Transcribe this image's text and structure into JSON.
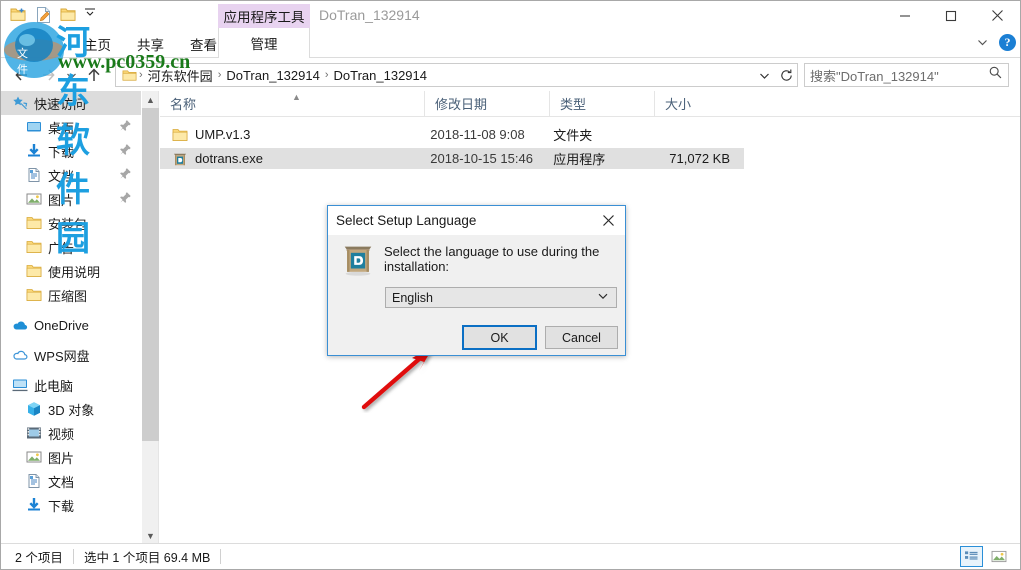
{
  "window": {
    "title": "DoTran_132914",
    "controls": {
      "minimize": "minimize-icon",
      "maximize": "maximize-icon",
      "close": "close-icon"
    },
    "help_label": "?"
  },
  "ribbon": {
    "tabs": [
      {
        "label": "主页",
        "name": "tab-home"
      },
      {
        "label": "共享",
        "name": "tab-share"
      },
      {
        "label": "查看",
        "name": "tab-view"
      }
    ],
    "contextual": {
      "band_label": "应用程序工具",
      "tab_label": "管理",
      "band_color": "#e8d3f0"
    },
    "collapse_icon": "chevron-down-icon"
  },
  "quick_access": {
    "icons": [
      "new-folder-icon",
      "properties-icon",
      "new-item-icon",
      "customize-chevron-icon"
    ]
  },
  "navigation": {
    "back": "back-arrow-icon",
    "forward": "forward-arrow-icon",
    "recent": "chevron-down-icon",
    "up": "up-arrow-icon",
    "breadcrumbs": [
      "河东软件园",
      "DoTran_132914",
      "DoTran_132914"
    ],
    "separator": "›",
    "dropdown_icon": "chevron-down-icon",
    "refresh_icon": "refresh-icon"
  },
  "search": {
    "value": "搜索\"DoTran_132914\"",
    "icon": "search-icon"
  },
  "sidebar": {
    "groups": [
      {
        "header": {
          "label": "快速访问",
          "icon": "star-pin-icon",
          "selected": true
        },
        "items": [
          {
            "label": "桌面",
            "icon": "desktop-icon",
            "pinned": true
          },
          {
            "label": "下载",
            "icon": "download-icon",
            "pinned": true
          },
          {
            "label": "文档",
            "icon": "documents-icon",
            "pinned": true
          },
          {
            "label": "图片",
            "icon": "pictures-icon",
            "pinned": true
          },
          {
            "label": "安装包",
            "icon": "folder-icon",
            "pinned": false
          },
          {
            "label": "广告",
            "icon": "folder-icon",
            "pinned": false
          },
          {
            "label": "使用说明",
            "icon": "folder-icon",
            "pinned": false
          },
          {
            "label": "压缩图",
            "icon": "folder-icon",
            "pinned": false
          }
        ]
      },
      {
        "header": {
          "label": "OneDrive",
          "icon": "onedrive-cloud-icon",
          "selected": false
        },
        "items": []
      },
      {
        "header": {
          "label": "WPS网盘",
          "icon": "wps-cloud-icon",
          "selected": false
        },
        "items": []
      },
      {
        "header": {
          "label": "此电脑",
          "icon": "this-pc-icon",
          "selected": false
        },
        "items": [
          {
            "label": "3D 对象",
            "icon": "3d-objects-icon",
            "pinned": false
          },
          {
            "label": "视频",
            "icon": "videos-icon",
            "pinned": false
          },
          {
            "label": "图片",
            "icon": "pictures-icon",
            "pinned": false
          },
          {
            "label": "文档",
            "icon": "documents-icon",
            "pinned": false
          },
          {
            "label": "下载",
            "icon": "download-icon",
            "pinned": false
          }
        ]
      }
    ],
    "scroll": {
      "up_icon": "scroll-up-icon",
      "down_icon": "scroll-down-icon"
    }
  },
  "filelist": {
    "columns": [
      {
        "label": "名称",
        "sorted": true,
        "sort_icon": "sort-ascending-icon"
      },
      {
        "label": "修改日期",
        "sorted": false
      },
      {
        "label": "类型",
        "sorted": false
      },
      {
        "label": "大小",
        "sorted": false
      }
    ],
    "rows": [
      {
        "name": "UMP.v1.3",
        "date": "2018-11-08 9:08",
        "type": "文件夹",
        "size": "",
        "icon": "folder-icon",
        "selected": false
      },
      {
        "name": "dotrans.exe",
        "date": "2018-10-15 15:46",
        "type": "应用程序",
        "size": "71,072 KB",
        "icon": "dotrans-app-icon",
        "selected": true
      }
    ]
  },
  "statusbar": {
    "item_count": "2 个项目",
    "selection": "选中 1 个项目  69.4 MB",
    "views": [
      {
        "name": "details-view-button",
        "icon": "details-view-icon",
        "active": true
      },
      {
        "name": "large-icons-view-button",
        "icon": "large-icons-view-icon",
        "active": false
      }
    ]
  },
  "dialog": {
    "title": "Select Setup Language",
    "close_icon": "close-icon",
    "app_icon": "setup-box-icon",
    "prompt": "Select the language to use during the installation:",
    "language_select": {
      "value": "English",
      "chevron": "chevron-down-icon"
    },
    "ok_label": "OK",
    "cancel_label": "Cancel",
    "accent_color": "#0b6fc4"
  },
  "annotation": {
    "arrow": "red-pointer-arrow",
    "color": "#e01010"
  },
  "watermark": {
    "line1": "河东软件园",
    "line2": "www.pc0359.cn",
    "badge_text": "文件",
    "color1": "#1d9fe0",
    "color2": "#1a7a1a"
  }
}
